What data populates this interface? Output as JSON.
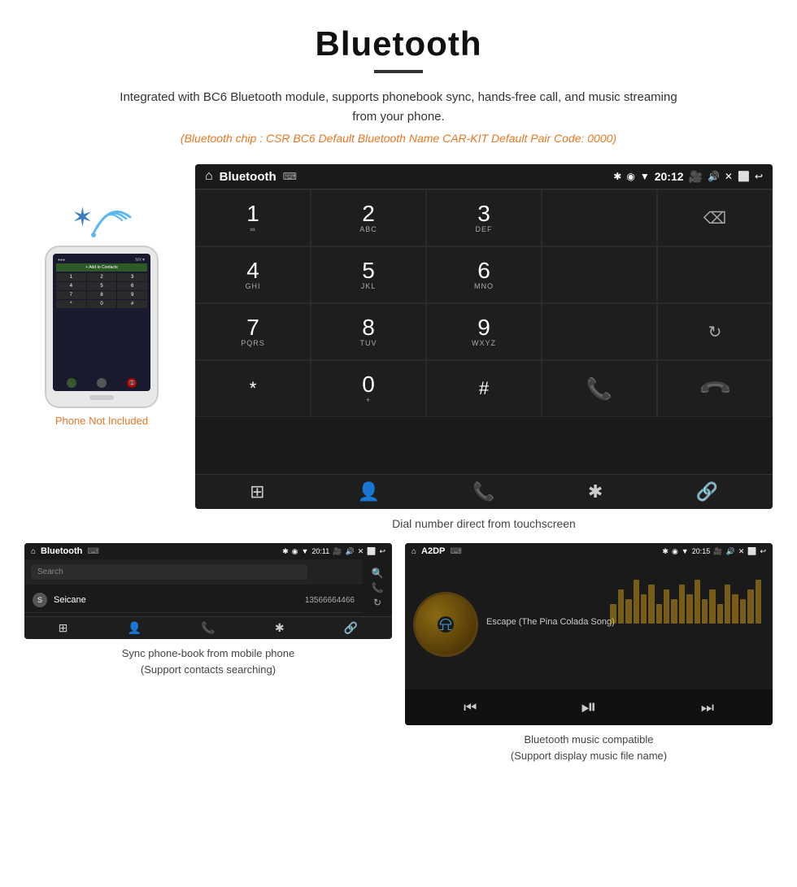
{
  "header": {
    "title": "Bluetooth",
    "description": "Integrated with BC6 Bluetooth module, supports phonebook sync, hands-free call, and music streaming from your phone.",
    "specs": "(Bluetooth chip : CSR BC6    Default Bluetooth Name CAR-KIT    Default Pair Code: 0000)",
    "phone_not_included": "Phone Not Included"
  },
  "car_screen": {
    "status_bar": {
      "title": "Bluetooth",
      "usb_icon": "⌨",
      "bt_icon": "✱",
      "location_icon": "◉",
      "signal_icon": "▼",
      "time": "20:12",
      "camera_icon": "📷",
      "volume_icon": "🔊",
      "close_icon": "✕",
      "window_icon": "⬜",
      "back_icon": "↩"
    },
    "dialpad": [
      {
        "num": "1",
        "sub": "∞",
        "type": "key"
      },
      {
        "num": "2",
        "sub": "ABC",
        "type": "key"
      },
      {
        "num": "3",
        "sub": "DEF",
        "type": "key"
      },
      {
        "num": "",
        "sub": "",
        "type": "empty"
      },
      {
        "num": "⌫",
        "sub": "",
        "type": "backspace"
      },
      {
        "num": "4",
        "sub": "GHI",
        "type": "key"
      },
      {
        "num": "5",
        "sub": "JKL",
        "type": "key"
      },
      {
        "num": "6",
        "sub": "MNO",
        "type": "key"
      },
      {
        "num": "",
        "sub": "",
        "type": "empty"
      },
      {
        "num": "",
        "sub": "",
        "type": "empty"
      },
      {
        "num": "7",
        "sub": "PQRS",
        "type": "key"
      },
      {
        "num": "8",
        "sub": "TUV",
        "type": "key"
      },
      {
        "num": "9",
        "sub": "WXYZ",
        "type": "key"
      },
      {
        "num": "",
        "sub": "",
        "type": "empty"
      },
      {
        "num": "↻",
        "sub": "",
        "type": "refresh"
      },
      {
        "num": "*",
        "sub": "",
        "type": "key"
      },
      {
        "num": "0",
        "sub": "+",
        "type": "key_plus"
      },
      {
        "num": "#",
        "sub": "",
        "type": "key"
      },
      {
        "num": "📞",
        "sub": "",
        "type": "call_green"
      },
      {
        "num": "📵",
        "sub": "",
        "type": "call_red"
      }
    ],
    "bottom_nav": [
      "⊞",
      "👤",
      "📞",
      "✱",
      "🔗"
    ]
  },
  "dial_caption": "Dial number direct from touchscreen",
  "phonebook_panel": {
    "status_bar": {
      "title": "Bluetooth",
      "usb": "⌨",
      "time": "20:11"
    },
    "search_placeholder": "Search",
    "contacts": [
      {
        "initial": "S",
        "name": "Seicane",
        "number": "13566664466"
      }
    ],
    "right_icons": [
      "🔍",
      "📞",
      "↻"
    ],
    "bottom_nav": [
      "⊞",
      "👤",
      "📞",
      "✱",
      "🔗"
    ],
    "caption_line1": "Sync phone-book from mobile phone",
    "caption_line2": "(Support contacts searching)"
  },
  "music_panel": {
    "status_bar": {
      "title": "A2DP",
      "usb": "⌨",
      "time": "20:15"
    },
    "song_title": "Escape (The Pina Colada Song)",
    "eq_bars": [
      4,
      7,
      5,
      9,
      6,
      8,
      4,
      7,
      5,
      8,
      6,
      9,
      5,
      7,
      4,
      8,
      6,
      5,
      7,
      9
    ],
    "controls": [
      "⏮",
      "⏯",
      "⏭"
    ],
    "caption_line1": "Bluetooth music compatible",
    "caption_line2": "(Support display music file name)"
  }
}
